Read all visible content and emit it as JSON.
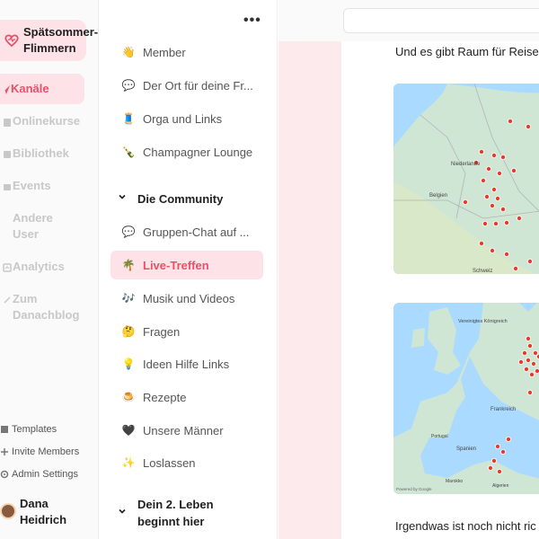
{
  "workspace": {
    "name_line1": "Spätsommer-",
    "name_line2": "Flimmern"
  },
  "nav": {
    "items": [
      {
        "label": "Kanäle",
        "icon": "send-icon"
      },
      {
        "label": "Onlinekurse",
        "icon": "course-icon"
      },
      {
        "label": "Bibliothek",
        "icon": "library-icon"
      },
      {
        "label": "Events",
        "icon": "calendar-icon"
      },
      {
        "label_line1": "Andere",
        "label_line2": "User",
        "icon": "users-icon"
      },
      {
        "label": "Analytics",
        "icon": "chart-icon"
      },
      {
        "label_line1": "Zum",
        "label_line2": "Danachblog",
        "icon": "link-icon"
      }
    ]
  },
  "bottom_links": {
    "templates": "Templates",
    "invite": "Invite Members",
    "admin": "Admin Settings"
  },
  "user": {
    "name_line1": "Dana",
    "name_line2": "Heidrich"
  },
  "channels": {
    "menu_glyph": "•••",
    "items": [
      {
        "emoji": "👋",
        "label": "Member"
      },
      {
        "emoji": "💬",
        "label": "Der Ort für deine Fr..."
      },
      {
        "emoji": "🧵",
        "label": "Orga und Links"
      },
      {
        "emoji": "🍾",
        "label": "Champagner Lounge"
      }
    ],
    "group1": "Die Community",
    "community": [
      {
        "emoji": "💬",
        "label": "Gruppen-Chat auf ..."
      },
      {
        "emoji": "🌴",
        "label": "Live-Treffen"
      },
      {
        "emoji": "🎶",
        "label": "Musik und Videos"
      },
      {
        "emoji": "🤔",
        "label": "Fragen"
      },
      {
        "emoji": "💡",
        "label": "Ideen Hilfe Links"
      },
      {
        "emoji": "🍮",
        "label": "Rezepte"
      },
      {
        "emoji": "🖤",
        "label": "Unsere Männer"
      },
      {
        "emoji": "✨",
        "label": "Loslassen"
      }
    ],
    "group2_line1": "Dein 2. Leben",
    "group2_line2": "beginnt hier"
  },
  "post": {
    "text1": "Und es gibt Raum für Reise",
    "text2": "Irgendwas ist noch nicht ric",
    "map1_labels": [
      "Niederlande",
      "Belgien",
      "Schweiz"
    ],
    "map2_labels": [
      "Vereinigtes Königreich",
      "Frankreich",
      "Spanien",
      "Portugal",
      "Marokko",
      "Algerien",
      "Powered by Google"
    ]
  },
  "colors": {
    "accent": "#e8506a",
    "accent_bg": "#fde3e7"
  }
}
